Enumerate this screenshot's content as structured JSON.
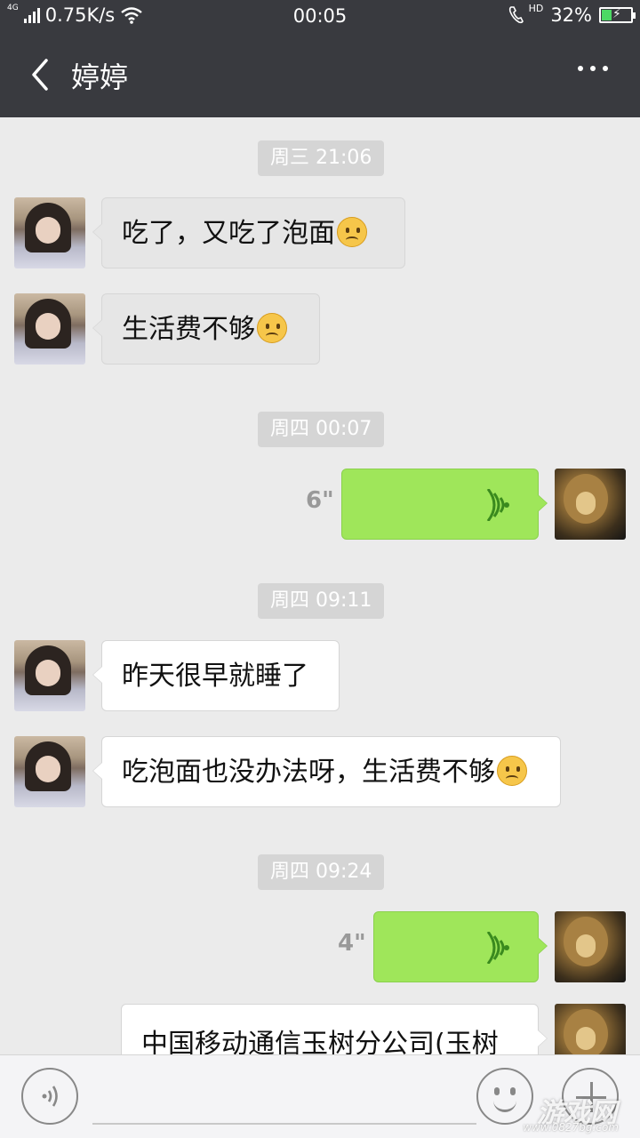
{
  "status_bar": {
    "network": "4G",
    "speed": "0.75K/s",
    "time": "00:05",
    "hd": "HD",
    "battery": "32%",
    "battery_level": 0.32
  },
  "header": {
    "title": "婷婷"
  },
  "messages": {
    "t1": "周三 21:06",
    "m1": "吃了，又吃了泡面",
    "m2": "生活费不够",
    "t2": "周四 00:07",
    "v1_duration": "6\"",
    "t3": "周四 09:11",
    "m3": "昨天很早就睡了",
    "m4": "吃泡面也没办法呀，生活费不够",
    "t4": "周四 09:24",
    "v2_duration": "4\"",
    "m5": "中国移动通信玉树分公司(玉树"
  },
  "watermark": {
    "text": "游戏网",
    "url": "www.0827bg.com"
  },
  "colors": {
    "header_bg": "#393a3f",
    "chat_bg": "#ebebeb",
    "sent_bubble": "#9fe65a"
  }
}
